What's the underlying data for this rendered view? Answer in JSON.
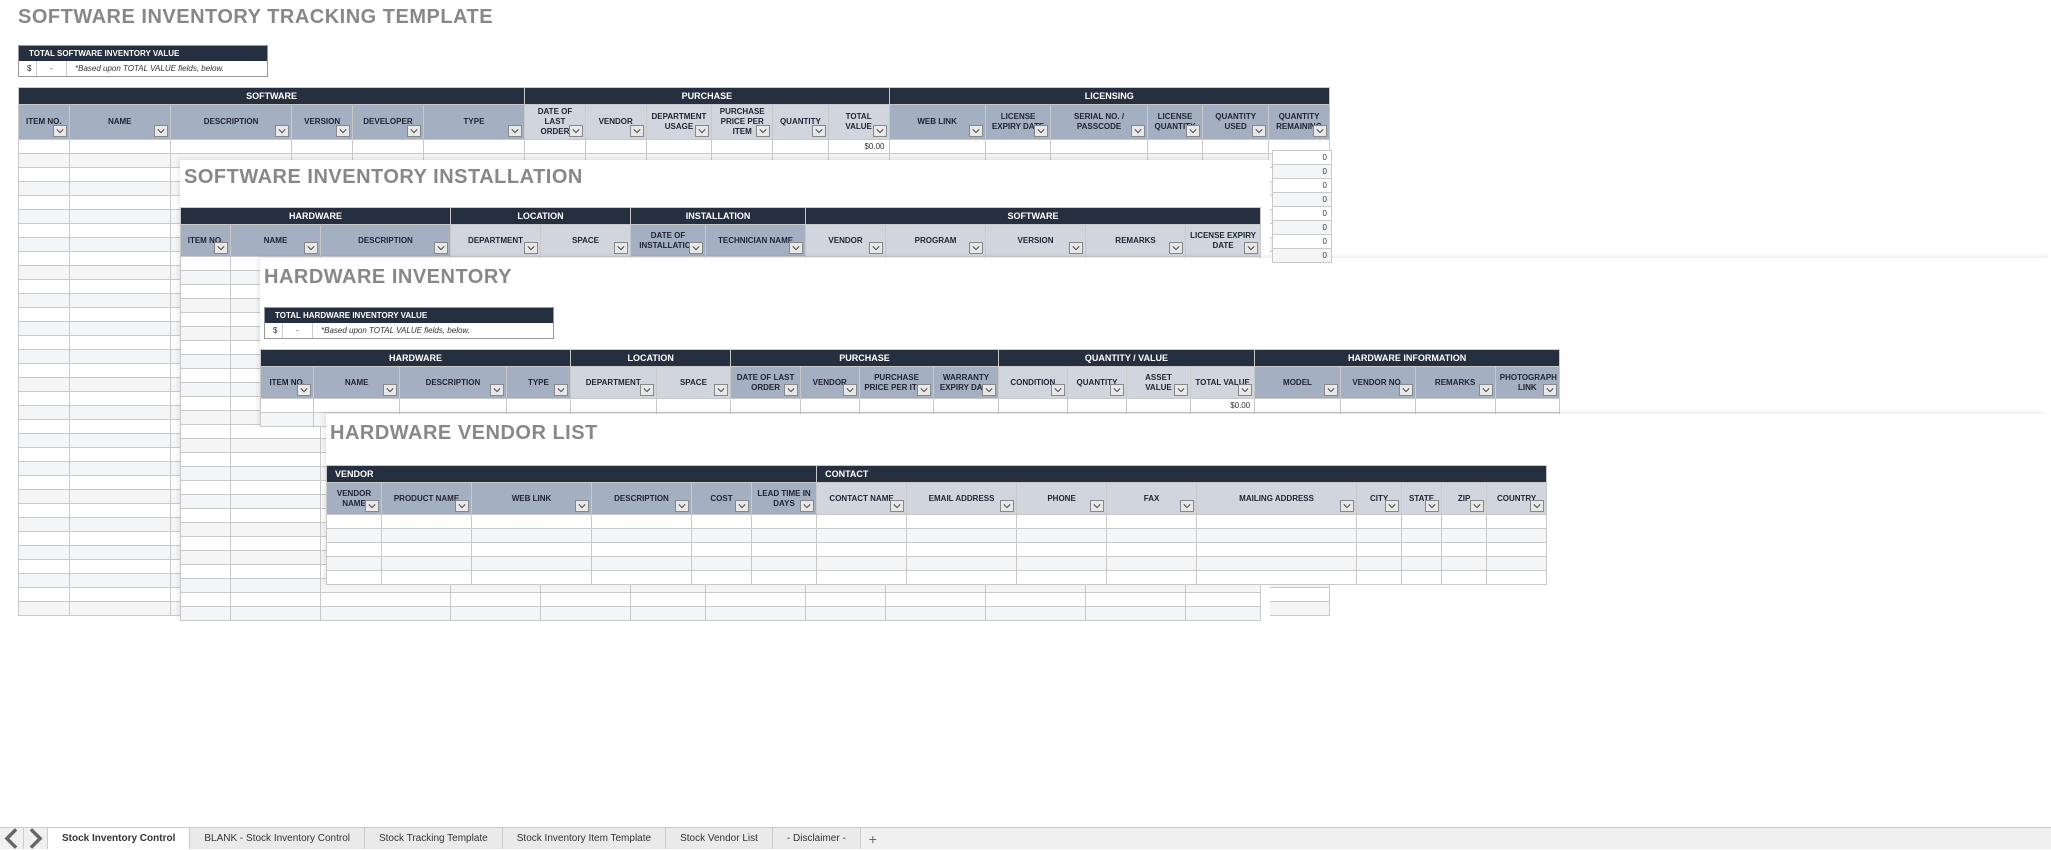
{
  "layer1": {
    "title": "SOFTWARE INVENTORY TRACKING TEMPLATE",
    "valuebox_head": "TOTAL SOFTWARE INVENTORY VALUE",
    "valuebox_currency": "$",
    "valuebox_dash": "-",
    "valuebox_note": "*Based upon TOTAL VALUE fields, below.",
    "groups": [
      "SOFTWARE",
      "PURCHASE",
      "LICENSING"
    ],
    "cols": [
      "ITEM NO.",
      "NAME",
      "DESCRIPTION",
      "VERSION",
      "DEVELOPER",
      "TYPE",
      "DATE OF LAST ORDER",
      "VENDOR",
      "DEPARTMENT USAGE",
      "PURCHASE PRICE PER ITEM",
      "QUANTITY",
      "TOTAL VALUE",
      "WEB LINK",
      "LICENSE EXPIRY DATE",
      "SERIAL NO. / PASSCODE",
      "LICENSE QUANTITY",
      "QUANTITY USED",
      "QUANTITY REMAINING"
    ],
    "firstTotal": "$0.00",
    "zeroRows": [
      "0",
      "0",
      "0",
      "0",
      "0",
      "0",
      "0",
      "0"
    ]
  },
  "layer2": {
    "title": "SOFTWARE INVENTORY INSTALLATION",
    "groups": [
      "HARDWARE",
      "LOCATION",
      "INSTALLATION",
      "SOFTWARE"
    ],
    "cols": [
      "ITEM NO.",
      "NAME",
      "DESCRIPTION",
      "DEPARTMENT",
      "SPACE",
      "DATE OF INSTALLATION",
      "TECHNICIAN NAME",
      "VENDOR",
      "PROGRAM",
      "VERSION",
      "REMARKS",
      "LICENSE EXPIRY DATE"
    ]
  },
  "layer3": {
    "title": "HARDWARE INVENTORY",
    "valuebox_head": "TOTAL HARDWARE INVENTORY VALUE",
    "valuebox_currency": "$",
    "valuebox_dash": "-",
    "valuebox_note": "*Based upon TOTAL VALUE fields, below.",
    "groups": [
      "HARDWARE",
      "LOCATION",
      "PURCHASE",
      "QUANTITY / VALUE",
      "HARDWARE INFORMATION"
    ],
    "cols": [
      "ITEM NO.",
      "NAME",
      "DESCRIPTION",
      "TYPE",
      "DEPARTMENT",
      "SPACE",
      "DATE OF LAST ORDER",
      "VENDOR",
      "PURCHASE PRICE PER ITEM",
      "WARRANTY EXPIRY DATE",
      "CONDITION",
      "QUANTITY",
      "ASSET VALUE",
      "TOTAL VALUE",
      "MODEL",
      "VENDOR NO.",
      "REMARKS",
      "PHOTOGRAPH LINK"
    ],
    "firstTotal": "$0.00"
  },
  "layer4": {
    "title": "HARDWARE VENDOR LIST",
    "groups": [
      "VENDOR",
      "CONTACT"
    ],
    "cols": [
      "VENDOR NAME",
      "PRODUCT NAME",
      "WEB LINK",
      "DESCRIPTION",
      "COST",
      "LEAD TIME IN DAYS",
      "CONTACT NAME",
      "EMAIL ADDRESS",
      "PHONE",
      "FAX",
      "MAILING ADDRESS",
      "CITY",
      "STATE",
      "ZIP",
      "COUNTRY"
    ]
  },
  "tabs": {
    "items": [
      "Stock Inventory Control",
      "BLANK - Stock Inventory Control",
      "Stock Tracking Template",
      "Stock Inventory Item Template",
      "Stock Vendor List",
      "- Disclaimer -"
    ],
    "active": 0
  }
}
